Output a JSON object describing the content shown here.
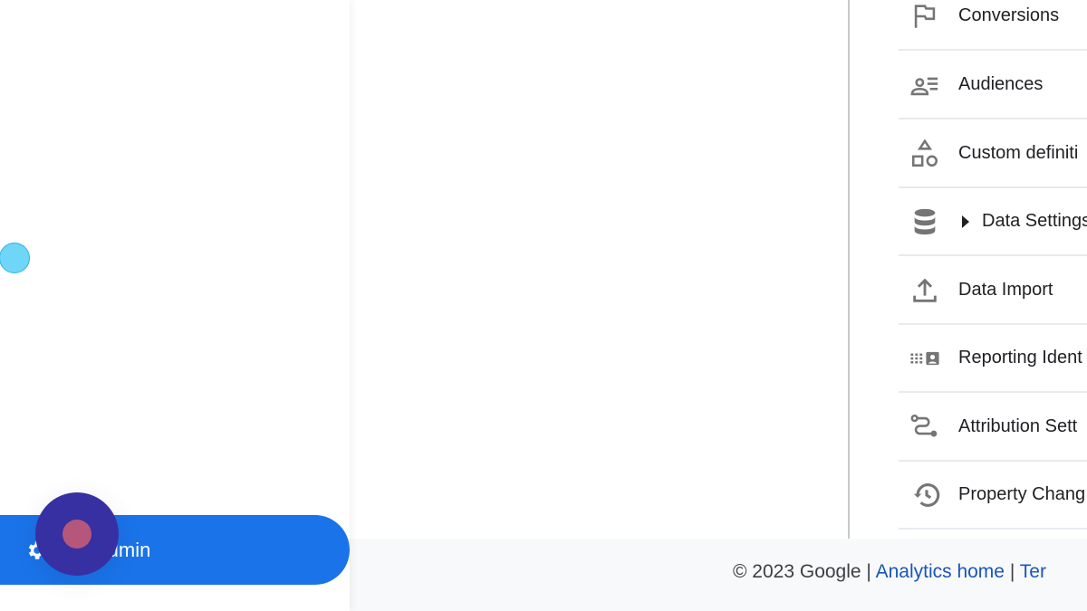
{
  "sidebar": {
    "admin_label": "Admin"
  },
  "property_menu": {
    "items": [
      {
        "label": "Conversions",
        "icon": "flag-icon"
      },
      {
        "label": "Audiences",
        "icon": "audience-icon"
      },
      {
        "label": "Custom definiti",
        "icon": "shapes-icon"
      },
      {
        "label": "Data Settings",
        "icon": "database-icon",
        "expandable": true
      },
      {
        "label": "Data Import",
        "icon": "upload-icon"
      },
      {
        "label": "Reporting Ident",
        "icon": "reporting-identity-icon"
      },
      {
        "label": "Attribution Sett",
        "icon": "route-icon"
      },
      {
        "label": "Property Chang",
        "icon": "history-icon"
      }
    ]
  },
  "footer": {
    "copyright": "© 2023 Google",
    "sep": "|",
    "link1": "Analytics home",
    "link2": "Ter"
  },
  "colors": {
    "accent": "#1a73e8",
    "link": "#1a56b8",
    "click_indicator": "#3730a3",
    "cursor": "#6fd6f7"
  }
}
